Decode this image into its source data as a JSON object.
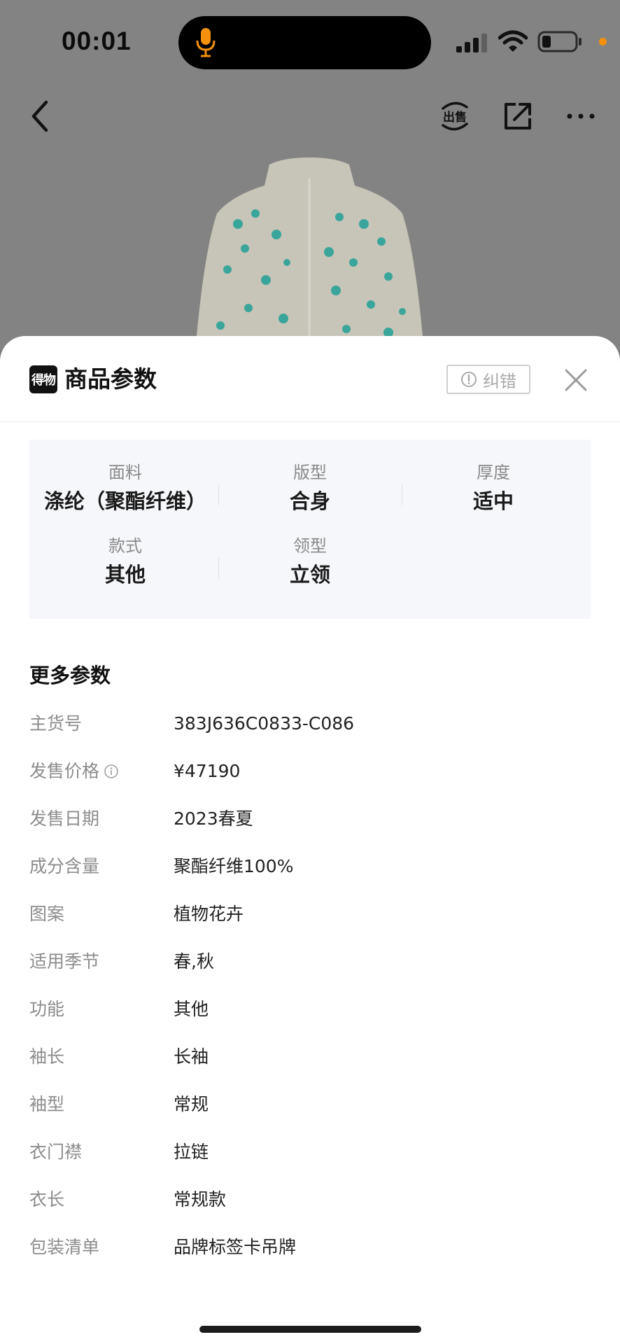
{
  "status_bar": {
    "time": "00:01"
  },
  "icons": {
    "back": "chevron-left-icon",
    "sell": "sell-icon",
    "share": "share-icon",
    "more": "more-dots-icon",
    "close": "close-icon",
    "report": "exclamation-circle-icon",
    "info": "info-circle-icon"
  },
  "nav": {
    "sell_label": "出售"
  },
  "sheet": {
    "logo_text": "得物",
    "title": "商品参数",
    "report_label": "纠错",
    "attributes": [
      {
        "label": "面料",
        "value": "涤纶（聚酯纤维）"
      },
      {
        "label": "版型",
        "value": "合身"
      },
      {
        "label": "厚度",
        "value": "适中"
      },
      {
        "label": "款式",
        "value": "其他"
      },
      {
        "label": "领型",
        "value": "立领"
      }
    ],
    "more_title": "更多参数",
    "params": [
      {
        "label": "主货号",
        "value": "383J636C0833-C086"
      },
      {
        "label": "发售价格",
        "value": "¥47190"
      },
      {
        "label": "发售日期",
        "value": "2023春夏"
      },
      {
        "label": "成分含量",
        "value": "聚酯纤维100%"
      },
      {
        "label": "图案",
        "value": "植物花卉"
      },
      {
        "label": "适用季节",
        "value": "春,秋"
      },
      {
        "label": "功能",
        "value": "其他"
      },
      {
        "label": "袖长",
        "value": "长袖"
      },
      {
        "label": "袖型",
        "value": "常规"
      },
      {
        "label": "衣门襟",
        "value": "拉链"
      },
      {
        "label": "衣长",
        "value": "常规款"
      },
      {
        "label": "包装清单",
        "value": "品牌标签卡吊牌"
      }
    ]
  },
  "colors": {
    "accent_orange": "#f4900c",
    "overlay": "#838383",
    "attr_bg": "#f6f7fa"
  }
}
